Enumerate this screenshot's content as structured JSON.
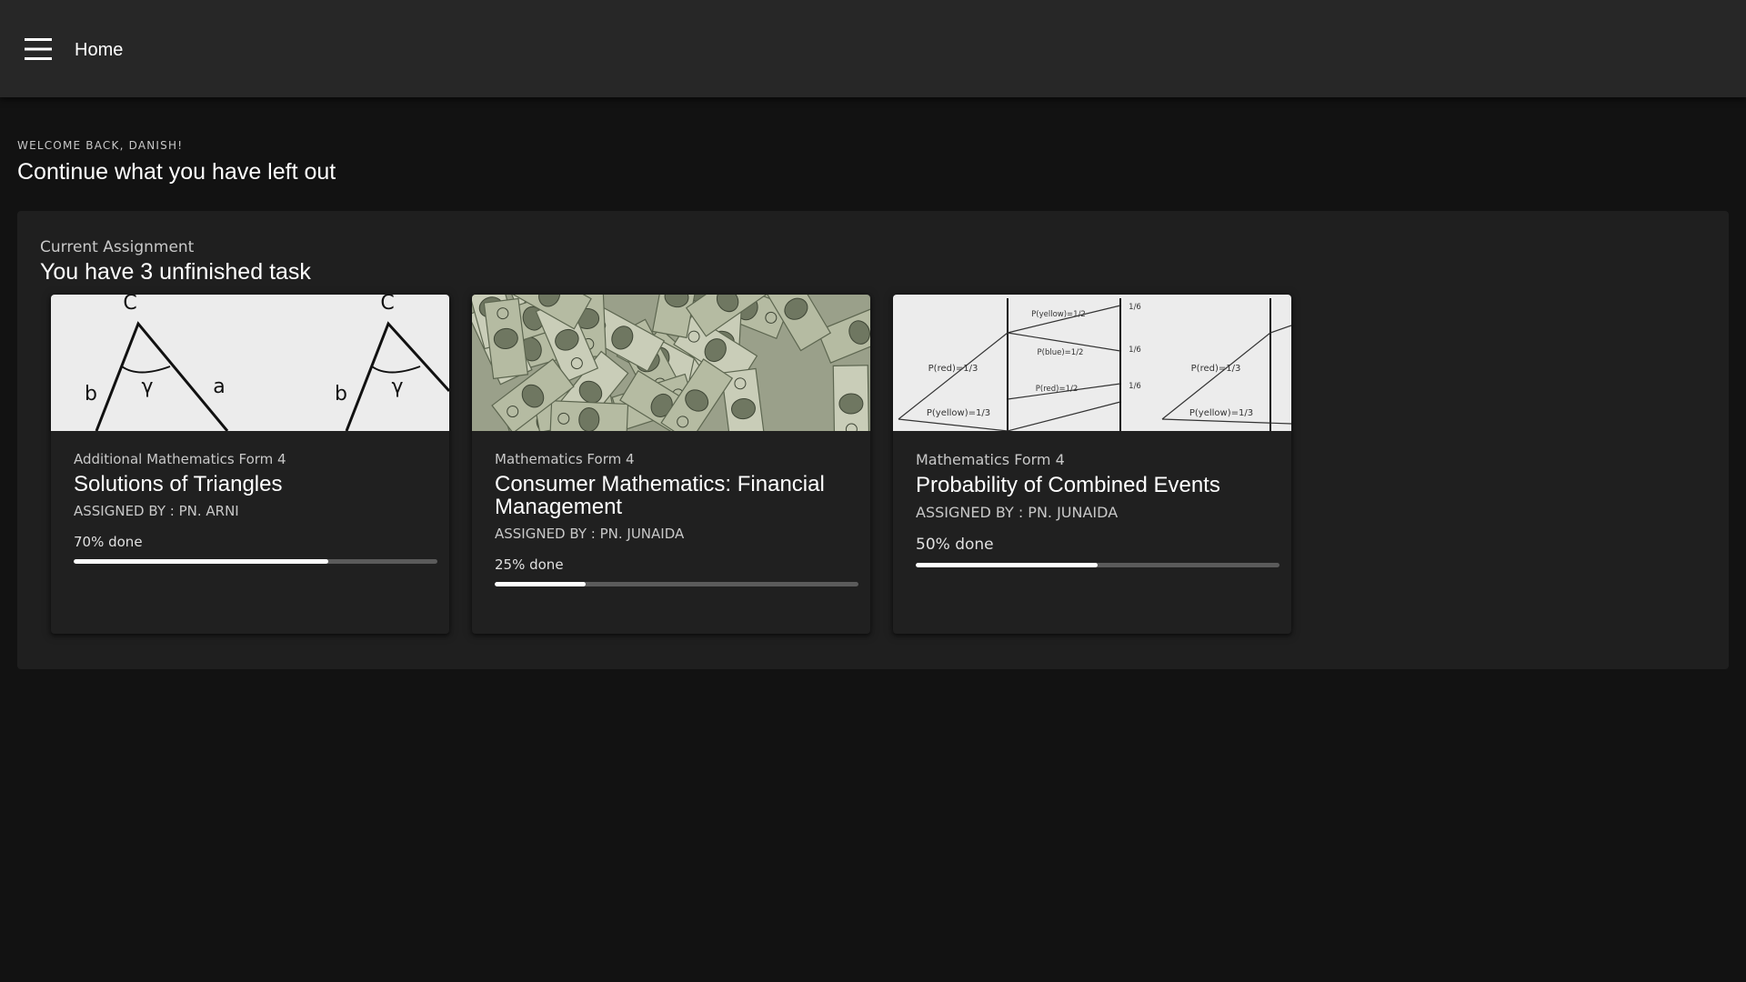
{
  "app_bar": {
    "menu_icon": "hamburger-menu-icon",
    "title": "Home"
  },
  "welcome": {
    "overline": "WELCOME BACK, DANISH!",
    "headline": "Continue what you have left out"
  },
  "assignments": {
    "overline": "Current Assignment",
    "title": "You have 3 unfinished task",
    "cards": [
      {
        "image": "triangle-diagram-image",
        "subject": "Additional Mathematics Form 4",
        "title": "Solutions of Triangles",
        "assigned_by": "ASSIGNED BY : PN. ARNI",
        "progress_label": "70% done",
        "progress": 0.7,
        "image_labels": {
          "angle_vertex": "C",
          "gamma": "γ",
          "side_b": "b",
          "side_a": "a"
        }
      },
      {
        "image": "money-bills-image",
        "subject": "Mathematics Form 4",
        "title": "Consumer Mathematics: Financial Management",
        "assigned_by": "ASSIGNED BY : PN. JUNAIDA",
        "progress_label": "25% done",
        "progress": 0.25
      },
      {
        "image": "probability-tree-image",
        "subject": "Mathematics Form 4",
        "title": "Probability of Combined Events",
        "assigned_by": "ASSIGNED BY : PN. JUNAIDA",
        "progress_label": "50% done",
        "progress": 0.5,
        "image_labels": {
          "p_red_third": "P(red)=1/3",
          "p_yellow_third": "P(yellow)=1/3",
          "p_yellow_half": "P(yellow)=1/2",
          "p_blue_half": "P(blue)=1/2",
          "p_red_half": "P(red)=1/2",
          "sixth": "1/6"
        }
      }
    ]
  },
  "colors": {
    "background": "#121212",
    "app_bar": "#272727",
    "panel": "#1f1f1f",
    "card": "#202020",
    "progress_fill": "#ffffff",
    "progress_track": "#5b5b5b"
  }
}
